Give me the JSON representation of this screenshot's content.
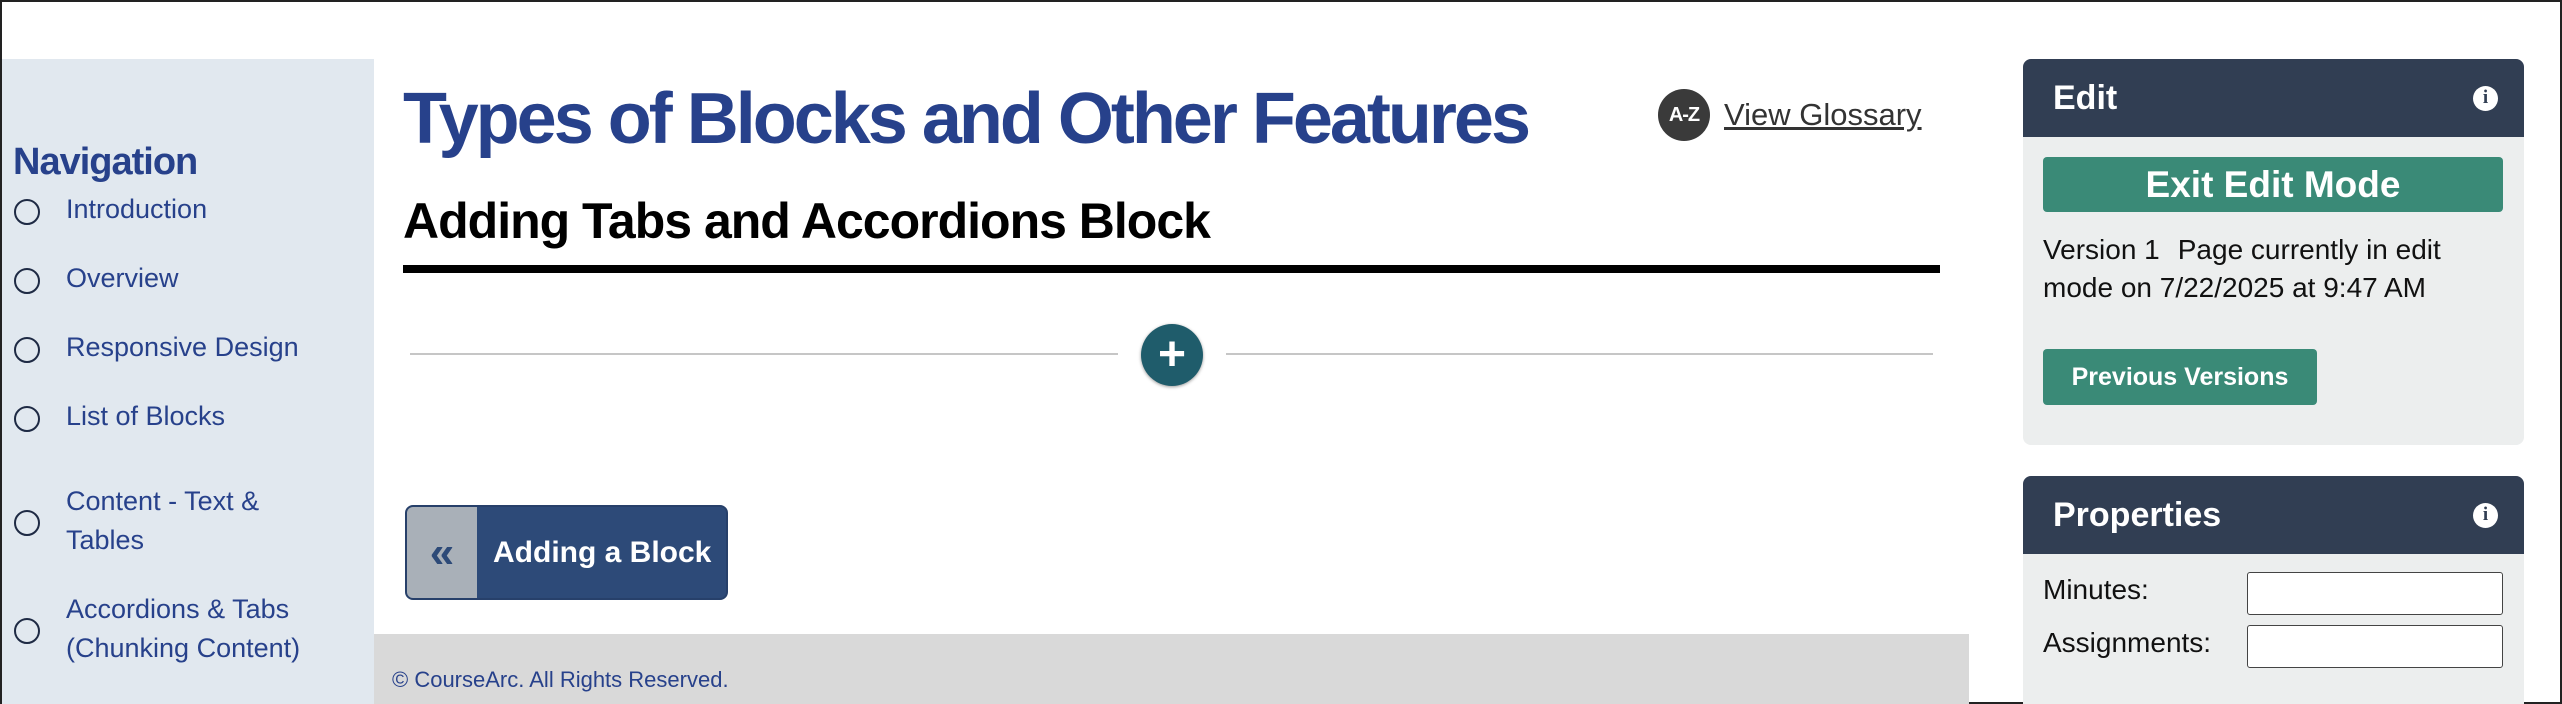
{
  "navigation": {
    "title": "Navigation",
    "items": [
      {
        "label": "Introduction"
      },
      {
        "label": "Overview"
      },
      {
        "label": "Responsive Design"
      },
      {
        "label": "List of Blocks"
      },
      {
        "label": "Content - Text & Tables"
      },
      {
        "label": "Accordions & Tabs (Chunking Content)"
      }
    ]
  },
  "main": {
    "page_title": "Types of Blocks and Other Features",
    "glossary_icon": "A-Z",
    "glossary_link": "View Glossary",
    "section_title": "Adding Tabs and Accordions Block",
    "add_block_icon": "+",
    "prev_page_icon": "«",
    "prev_page_label": "Adding a Block"
  },
  "footer": {
    "text": "© CourseArc. All Rights Reserved."
  },
  "edit_panel": {
    "title": "Edit",
    "info_icon": "i",
    "exit_button": "Exit Edit Mode",
    "version": "Version 1",
    "status": "Page currently in edit mode on 7/22/2025 at 9:47 AM",
    "previous_versions_button": "Previous Versions"
  },
  "properties_panel": {
    "title": "Properties",
    "info_icon": "i",
    "fields": [
      {
        "label": "Minutes:",
        "value": ""
      },
      {
        "label": "Assignments:",
        "value": ""
      }
    ]
  }
}
